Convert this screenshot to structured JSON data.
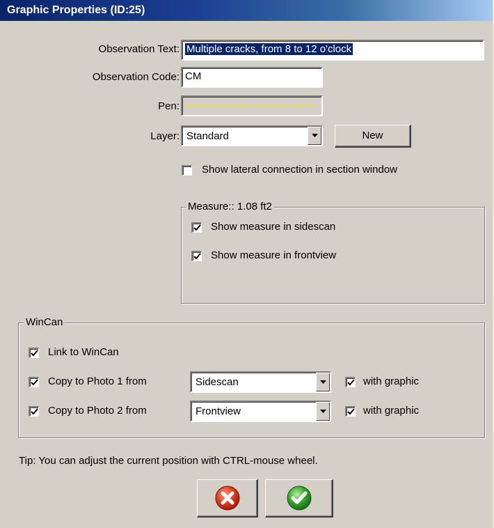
{
  "window": {
    "title": "Graphic Properties (ID:25)"
  },
  "form": {
    "observation_text_label": "Observation Text:",
    "observation_text_value": "Multiple cracks, from 8 to 12 o'clock",
    "observation_code_label": "Observation Code:",
    "observation_code_value": "CM",
    "pen_label": "Pen:",
    "pen_color": "#ffe000",
    "layer_label": "Layer:",
    "layer_value": "Standard",
    "new_button": "New",
    "show_lateral_label": "Show lateral connection in section window",
    "show_lateral_checked": false
  },
  "measure": {
    "title": "Measure:: 1.08 ft2",
    "sidescan_label": "Show measure in sidescan",
    "sidescan_checked": true,
    "frontview_label": "Show measure in frontview",
    "frontview_checked": true
  },
  "wincan": {
    "title": "WinCan",
    "link_label": "Link to WinCan",
    "link_checked": true,
    "photo1_label": "Copy to Photo 1 from",
    "photo1_checked": true,
    "photo1_source": "Sidescan",
    "photo1_graphic_label": "with graphic",
    "photo1_graphic_checked": true,
    "photo2_label": "Copy to Photo 2 from",
    "photo2_checked": true,
    "photo2_source": "Frontview",
    "photo2_graphic_label": "with graphic",
    "photo2_graphic_checked": true
  },
  "tip": "Tip: You can adjust the current position with CTRL-mouse wheel.",
  "buttons": {
    "cancel_icon": "cancel-x-icon",
    "ok_icon": "ok-check-icon"
  },
  "colors": {
    "titlebar": "#0a246a",
    "dialog_bg": "#d4d0c8",
    "selection": "#0a246a",
    "cancel_red": "#d63a1e",
    "ok_green": "#3aa72c"
  }
}
